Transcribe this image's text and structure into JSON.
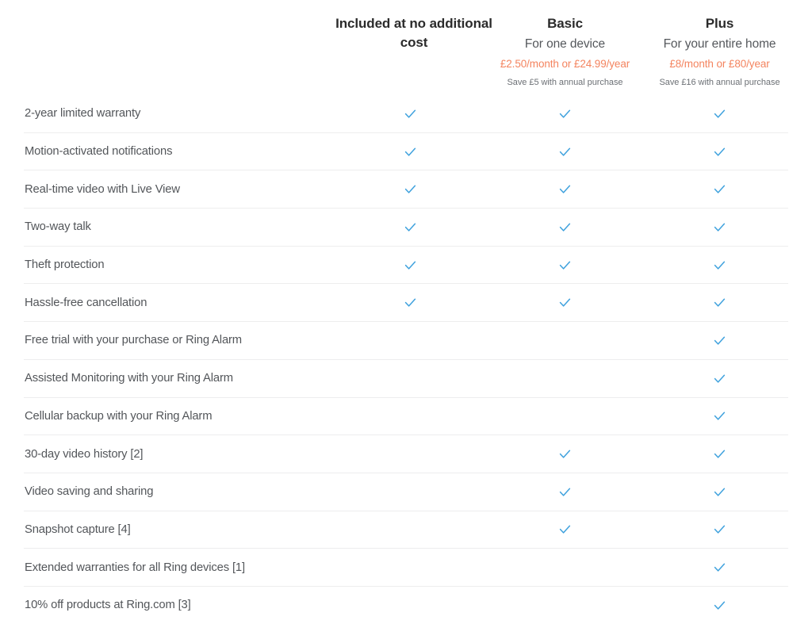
{
  "table": {
    "columns": [
      {
        "key": "free",
        "title": "Included at no additional cost",
        "subtitle": "",
        "price": "",
        "save": ""
      },
      {
        "key": "basic",
        "title": "Basic",
        "subtitle": "For one device",
        "price": "£2.50/month or £24.99/year",
        "save": "Save £5 with annual purchase"
      },
      {
        "key": "plus",
        "title": "Plus",
        "subtitle": "For your entire home",
        "price": "£8/month or £80/year",
        "save": "Save £16 with annual purchase"
      }
    ],
    "check_icon": "check-icon",
    "check_color": "#3ea1dd",
    "accent_price_color": "#f4845f",
    "rows": [
      {
        "label": "2-year limited warranty",
        "free": true,
        "basic": true,
        "plus": true
      },
      {
        "label": "Motion-activated notifications",
        "free": true,
        "basic": true,
        "plus": true
      },
      {
        "label": "Real-time video with Live View",
        "free": true,
        "basic": true,
        "plus": true
      },
      {
        "label": "Two-way talk",
        "free": true,
        "basic": true,
        "plus": true
      },
      {
        "label": "Theft protection",
        "free": true,
        "basic": true,
        "plus": true
      },
      {
        "label": "Hassle-free cancellation",
        "free": true,
        "basic": true,
        "plus": true
      },
      {
        "label": "Free trial with your purchase or Ring Alarm",
        "free": false,
        "basic": false,
        "plus": true
      },
      {
        "label": "Assisted Monitoring with your Ring Alarm",
        "free": false,
        "basic": false,
        "plus": true
      },
      {
        "label": "Cellular backup with your Ring Alarm",
        "free": false,
        "basic": false,
        "plus": true
      },
      {
        "label": "30-day video history [2]",
        "free": false,
        "basic": true,
        "plus": true
      },
      {
        "label": "Video saving and sharing",
        "free": false,
        "basic": true,
        "plus": true
      },
      {
        "label": "Snapshot capture [4]",
        "free": false,
        "basic": true,
        "plus": true
      },
      {
        "label": "Extended warranties for all Ring devices [1]",
        "free": false,
        "basic": false,
        "plus": true
      },
      {
        "label": "10% off products at Ring.com [3]",
        "free": false,
        "basic": false,
        "plus": true
      }
    ]
  }
}
